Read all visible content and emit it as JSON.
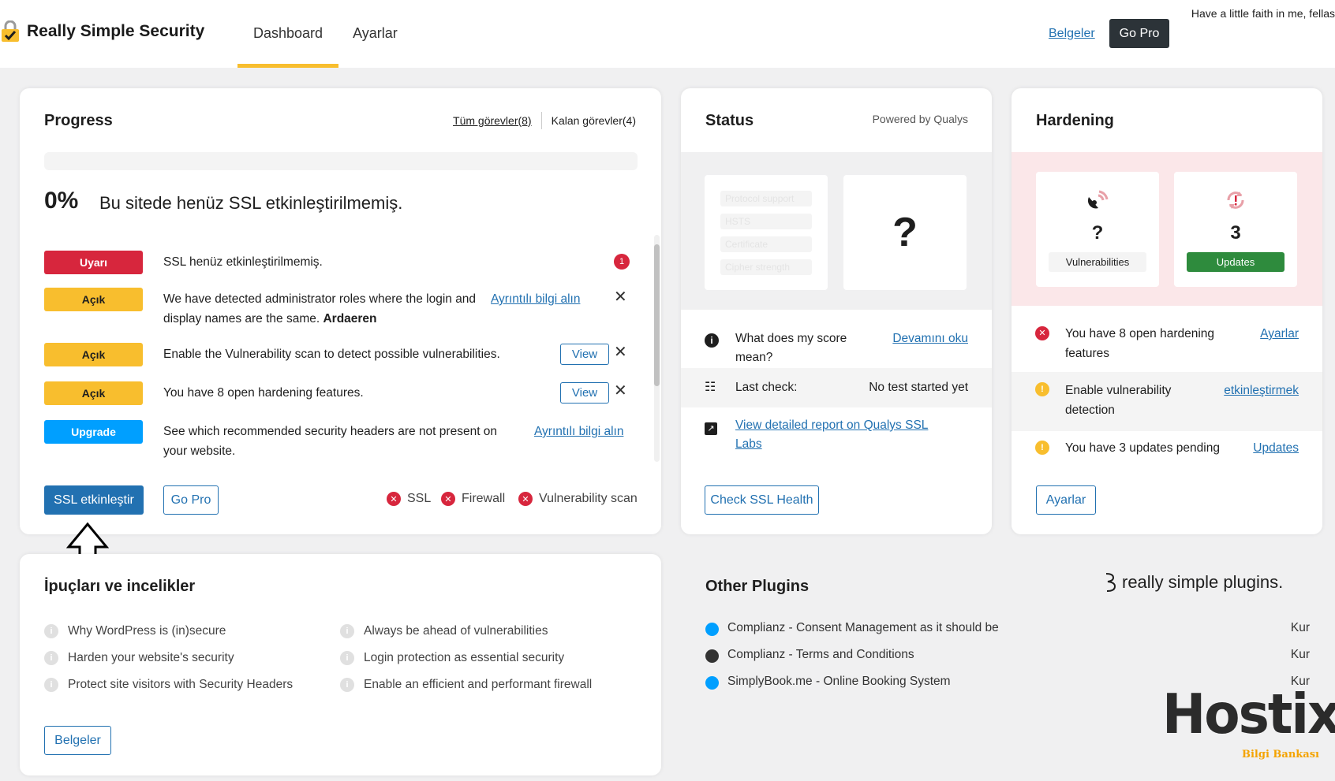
{
  "header": {
    "brand": "Really Simple Security",
    "nav": [
      "Dashboard",
      "Ayarlar"
    ],
    "tagline": "Have a little faith in me, fellas",
    "docs_link": "Belgeler",
    "gopro": "Go Pro",
    "colors": {
      "accent": "#f8be2e",
      "dark": "#2c3338"
    }
  },
  "progress": {
    "title": "Progress",
    "all_tasks": "Tüm görevler(8)",
    "remaining_tasks": "Kalan görevler(4)",
    "percent": "0%",
    "headline": "Bu sitede henüz SSL etkinleştirilmemiş.",
    "tasks": [
      {
        "badge": "Uyarı",
        "text": "SSL henüz etkinleştirilmemiş.",
        "count": "1"
      },
      {
        "badge": "Açık",
        "text": "We have detected administrator roles where the login and display names are the same.",
        "bold": "Ardaeren",
        "link": "Ayrıntılı bilgi alın"
      },
      {
        "badge": "Açık",
        "text": "Enable the Vulnerability scan to detect possible vulnerabilities.",
        "button": "View"
      },
      {
        "badge": "Açık",
        "text": "You have 8 open hardening features.",
        "button": "View"
      },
      {
        "badge": "Upgrade",
        "text": "See which recommended security headers are not present on your website.",
        "link": "Ayrıntılı bilgi alın"
      }
    ],
    "enable_ssl": "SSL etkinleştir",
    "gopro": "Go Pro",
    "features": [
      "SSL",
      "Firewall",
      "Vulnerability scan"
    ]
  },
  "status": {
    "title": "Status",
    "powered": "Powered by Qualys",
    "ghosts": [
      "Protocol support",
      "HSTS",
      "Certificate",
      "Cipher strength"
    ],
    "grade": "?",
    "score_q": "What does my score mean?",
    "score_link": "Devamını oku",
    "last_check_label": "Last check:",
    "last_check_value": "No test started yet",
    "report_link": "View detailed report on Qualys SSL Labs",
    "check_btn": "Check SSL Health"
  },
  "hardening": {
    "title": "Hardening",
    "vuln_value": "?",
    "vuln_label": "Vulnerabilities",
    "updates_value": "3",
    "updates_label": "Updates",
    "rows": [
      {
        "text": "You have 8 open hardening features",
        "link": "Ayarlar"
      },
      {
        "text": "Enable vulnerability detection",
        "link": "etkinleştirmek"
      },
      {
        "text": "You have 3 updates pending",
        "link": "Updates"
      }
    ],
    "settings_btn": "Ayarlar"
  },
  "tips": {
    "title": "İpuçları ve incelikler",
    "items": [
      "Why WordPress is (in)secure",
      "Harden your website's security",
      "Protect site visitors with Security Headers",
      "Always be ahead of vulnerabilities",
      "Login protection as essential security",
      "Enable an efficient and performant firewall"
    ],
    "docs_btn": "Belgeler"
  },
  "other_plugins": {
    "title": "Other Plugins",
    "brand": "really simple plugins.",
    "items": [
      {
        "name": "Complianz - Consent Management as it should be",
        "action": "Kur",
        "color": "#009fff"
      },
      {
        "name": "Complianz - Terms and Conditions",
        "action": "Kur",
        "color": "#333333"
      },
      {
        "name": "SimplyBook.me - Online Booking System",
        "action": "Kur",
        "color": "#009fff"
      }
    ]
  },
  "watermark": {
    "name": "Hostixo",
    "sub": "Bilgi Bankası"
  }
}
